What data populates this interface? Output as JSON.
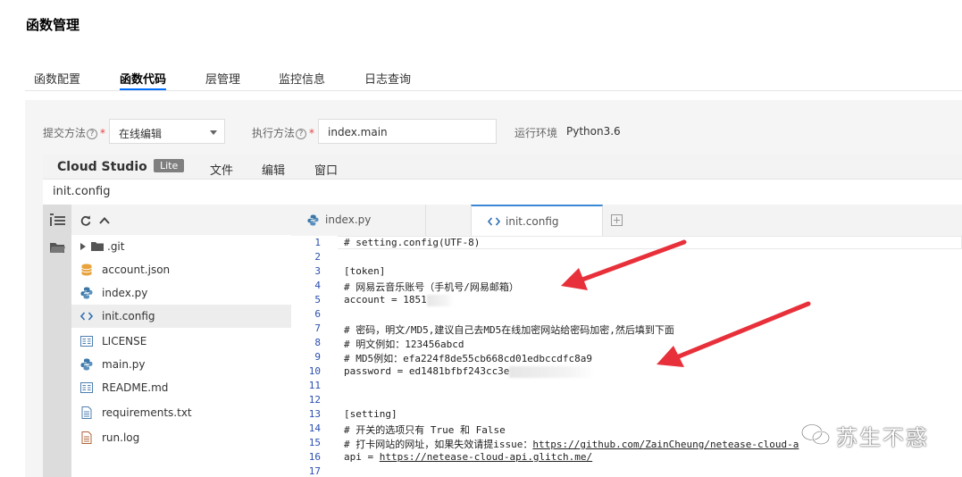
{
  "page": {
    "title": "函数管理"
  },
  "tabs": [
    {
      "label": "函数配置",
      "active": false
    },
    {
      "label": "函数代码",
      "active": true
    },
    {
      "label": "层管理",
      "active": false
    },
    {
      "label": "监控信息",
      "active": false
    },
    {
      "label": "日志查询",
      "active": false
    }
  ],
  "form": {
    "submit_label": "提交方法",
    "submit_value": "在线编辑",
    "exec_label": "执行方法",
    "exec_value": "index.main",
    "runtime_label": "运行环境",
    "runtime_value": "Python3.6",
    "help_glyph": "?",
    "required_mark": "*"
  },
  "ide": {
    "brand": "Cloud Studio",
    "badge": "Lite",
    "menus": [
      "文件",
      "编辑",
      "窗口"
    ],
    "title": "init.config"
  },
  "sidebar": {
    "items": [
      {
        "label": ".git",
        "icon": "folder-icon"
      },
      {
        "label": "account.json",
        "icon": "database-icon"
      },
      {
        "label": "index.py",
        "icon": "python-icon"
      },
      {
        "label": "init.config",
        "icon": "code-icon",
        "active": true
      },
      {
        "label": "LICENSE",
        "icon": "document-icon"
      },
      {
        "label": "main.py",
        "icon": "python-icon"
      },
      {
        "label": "README.md",
        "icon": "document-icon"
      },
      {
        "label": "requirements.txt",
        "icon": "text-file-icon"
      },
      {
        "label": "run.log",
        "icon": "log-file-icon"
      }
    ]
  },
  "editor": {
    "tabs": [
      {
        "label": "index.py",
        "icon": "python-icon"
      },
      {
        "label": "init.config",
        "icon": "code-icon",
        "active": true
      }
    ],
    "lines": [
      "# setting.config(UTF-8)",
      "",
      "[token]",
      "# 网易云音乐账号（手机号/网易邮箱）",
      "account = 1851",
      "",
      "# 密码，明文/MD5,建议自己去MD5在线加密网站给密码加密,然后填到下面",
      "# 明文例如：123456abcd",
      "# MD5例如：efa224f8de55cb668cd01edbccdfc8a9",
      "password = ed1481bfbf243cc3e",
      "",
      "",
      "[setting]",
      "# 开关的选项只有 True 和 False",
      "# 打卡网站的网址，如果失效请提issue：https://github.com/ZainCheung/netease-cloud-a",
      "api = https://netease-cloud-api.glitch.me/",
      ""
    ],
    "line_numbers": [
      "1",
      "2",
      "3",
      "4",
      "5",
      "6",
      "7",
      "8",
      "9",
      "10",
      "11",
      "12",
      "13",
      "14",
      "15",
      "16",
      "17"
    ]
  },
  "colors": {
    "accent": "#006eff",
    "arrow": "#e8303a",
    "line_number": "#2a4fb0"
  },
  "watermark": {
    "text": "苏生不惑"
  }
}
